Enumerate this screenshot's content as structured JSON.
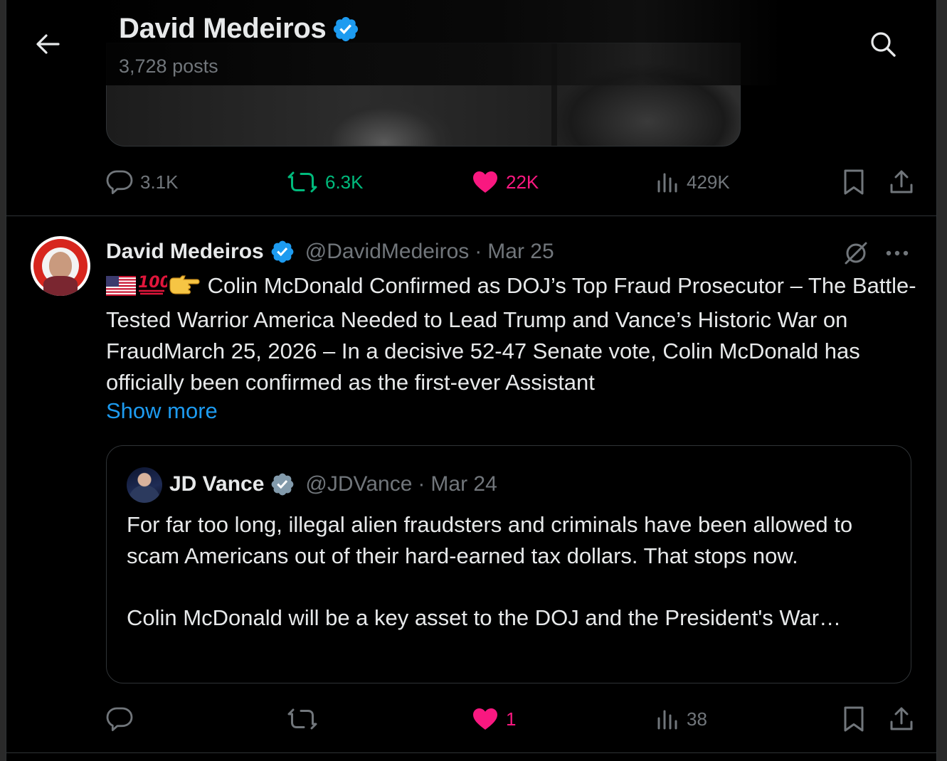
{
  "header": {
    "name": "David Medeiros",
    "posts_count": "3,728 posts"
  },
  "prev_tweet": {
    "replies": "3.1K",
    "reposts": "6.3K",
    "likes": "22K",
    "views": "429K"
  },
  "tweet": {
    "name": "David Medeiros",
    "handle": "@DavidMedeiros",
    "separator": "·",
    "date": "Mar 25",
    "emoji_prefix": [
      "us-flag-icon",
      "hundred-points-icon",
      "backhand-pointing-right-icon"
    ],
    "text": "Colin McDonald Confirmed as DOJ’s Top Fraud Prosecutor – The Battle-Tested Warrior America Needed to Lead Trump and Vance’s Historic War on FraudMarch 25, 2026 – In a decisive 52-47 Senate vote, Colin McDonald has officially been confirmed as the first-ever Assistant",
    "show_more": "Show more",
    "quote": {
      "name": "JD Vance",
      "handle": "@JDVance",
      "separator": "·",
      "date": "Mar 24",
      "text_p1": "For far too long, illegal alien fraudsters and criminals have been allowed to scam Americans out of their hard-earned tax dollars. That stops now.",
      "text_p2": "Colin McDonald will be a key asset to the DOJ and the President's War…"
    },
    "metrics": {
      "replies": "",
      "reposts": "",
      "likes": "1",
      "views": "38"
    }
  },
  "colors": {
    "background": "#000000",
    "text": "#e7e9ea",
    "muted": "#71767b",
    "accent_blue": "#1d9bf0",
    "verified_gray": "#829aab",
    "repost_green": "#00ba7c",
    "like_pink": "#f91880",
    "border": "#2f3336"
  }
}
